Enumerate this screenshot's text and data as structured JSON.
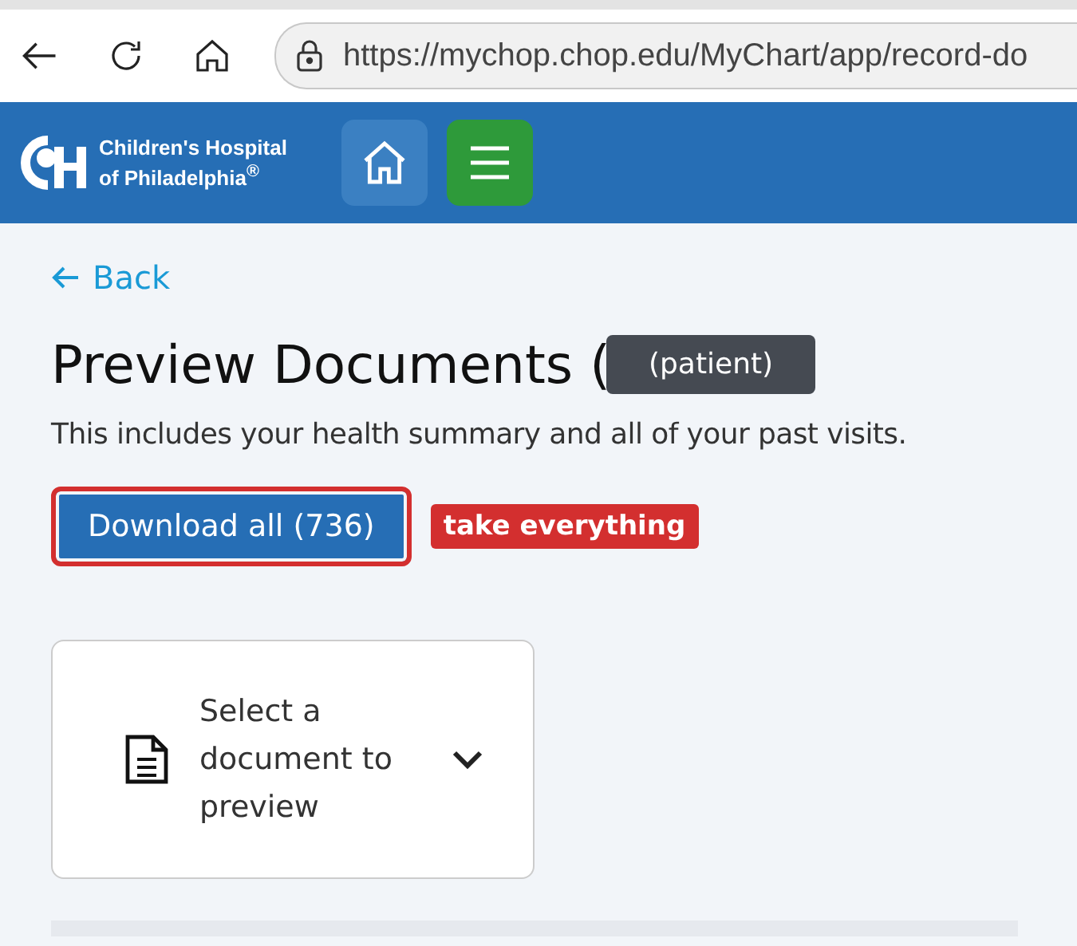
{
  "browser": {
    "url": "https://mychop.chop.edu/MyChart/app/record-do"
  },
  "header": {
    "logo_line_1": "Children's Hospital",
    "logo_line_2": "of Philadelphia$^{®}$"
  },
  "back_link": "Back",
  "title": "Preview Documents (",
  "redaction_label": "(patient)",
  "description": "This includes your health summary and all of your past visits.",
  "download_button": {
    "label": "Download all (736)",
    "highlighted": true
  },
  "annotation": "take everything",
  "document_select": {
    "placeholder": "Select a document to preview",
    "expanded": false
  }
}
